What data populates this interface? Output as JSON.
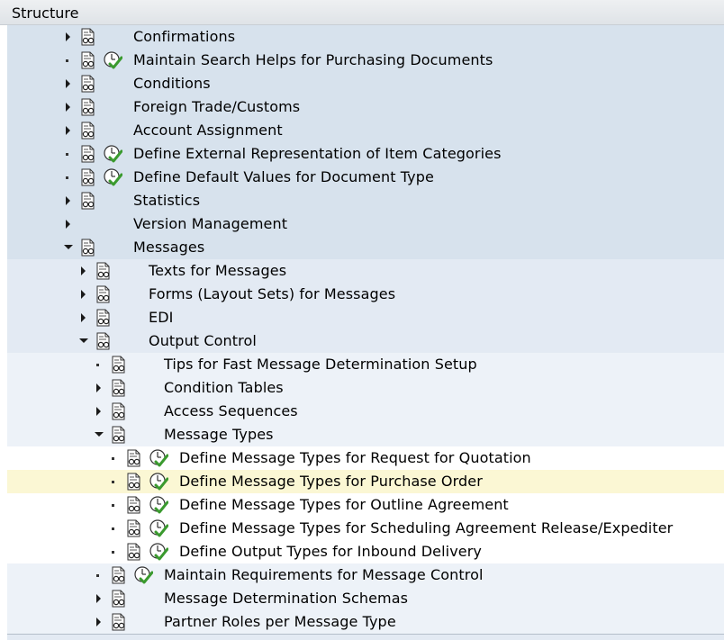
{
  "header": {
    "title": "Structure"
  },
  "tree": {
    "rows": [
      {
        "label": "Confirmations",
        "depth": 0,
        "toggle": "collapsed",
        "doc": true,
        "exec": false
      },
      {
        "label": "Maintain Search Helps for Purchasing Documents",
        "depth": 0,
        "toggle": "leaf",
        "doc": true,
        "exec": true
      },
      {
        "label": "Conditions",
        "depth": 0,
        "toggle": "collapsed",
        "doc": true,
        "exec": false
      },
      {
        "label": "Foreign Trade/Customs",
        "depth": 0,
        "toggle": "collapsed",
        "doc": true,
        "exec": false
      },
      {
        "label": "Account Assignment",
        "depth": 0,
        "toggle": "collapsed",
        "doc": true,
        "exec": false
      },
      {
        "label": "Define External Representation of Item Categories",
        "depth": 0,
        "toggle": "leaf",
        "doc": true,
        "exec": true
      },
      {
        "label": "Define Default Values for Document Type",
        "depth": 0,
        "toggle": "leaf",
        "doc": true,
        "exec": true
      },
      {
        "label": "Statistics",
        "depth": 0,
        "toggle": "collapsed",
        "doc": true,
        "exec": false
      },
      {
        "label": "Version Management",
        "depth": 0,
        "toggle": "collapsed",
        "doc": false,
        "exec": false
      },
      {
        "label": "Messages",
        "depth": 0,
        "toggle": "expanded",
        "doc": true,
        "exec": false
      },
      {
        "label": "Texts for Messages",
        "depth": 1,
        "toggle": "collapsed",
        "doc": true,
        "exec": false
      },
      {
        "label": "Forms (Layout Sets) for Messages",
        "depth": 1,
        "toggle": "collapsed",
        "doc": true,
        "exec": false
      },
      {
        "label": "EDI",
        "depth": 1,
        "toggle": "collapsed",
        "doc": true,
        "exec": false
      },
      {
        "label": "Output Control",
        "depth": 1,
        "toggle": "expanded",
        "doc": true,
        "exec": false
      },
      {
        "label": "Tips for Fast Message Determination Setup",
        "depth": 2,
        "toggle": "leaf",
        "doc": true,
        "exec": false
      },
      {
        "label": "Condition Tables",
        "depth": 2,
        "toggle": "collapsed",
        "doc": true,
        "exec": false
      },
      {
        "label": "Access Sequences",
        "depth": 2,
        "toggle": "collapsed",
        "doc": true,
        "exec": false
      },
      {
        "label": "Message Types",
        "depth": 2,
        "toggle": "expanded",
        "doc": true,
        "exec": false
      },
      {
        "label": "Define Message Types for Request for Quotation",
        "depth": 3,
        "toggle": "leaf",
        "doc": true,
        "exec": true
      },
      {
        "label": "Define Message Types for Purchase Order",
        "depth": 3,
        "toggle": "leaf",
        "doc": true,
        "exec": true,
        "selected": true
      },
      {
        "label": "Define Message Types for Outline Agreement",
        "depth": 3,
        "toggle": "leaf",
        "doc": true,
        "exec": true
      },
      {
        "label": "Define Message Types for Scheduling Agreement Release/Expediter",
        "depth": 3,
        "toggle": "leaf",
        "doc": true,
        "exec": true
      },
      {
        "label": "Define Output Types for Inbound Delivery",
        "depth": 3,
        "toggle": "leaf",
        "doc": true,
        "exec": true
      },
      {
        "label": "Maintain Requirements for Message Control",
        "depth": 2,
        "toggle": "leaf",
        "doc": true,
        "exec": true
      },
      {
        "label": "Message Determination Schemas",
        "depth": 2,
        "toggle": "collapsed",
        "doc": true,
        "exec": false
      },
      {
        "label": "Partner Roles per Message Type",
        "depth": 2,
        "toggle": "collapsed",
        "doc": true,
        "exec": false
      }
    ]
  },
  "colors": {
    "depth0_bg": "#d7e2ed",
    "depth1_bg": "#e3eaf3",
    "depth2_bg": "#edf2f8",
    "depth3_bg": "#ffffff",
    "selected_bg": "#fbf7d4",
    "exec_check": "#3a9a2e"
  },
  "icons": {
    "doc": "document-glasses-icon",
    "exec": "execute-clock-check-icon"
  }
}
